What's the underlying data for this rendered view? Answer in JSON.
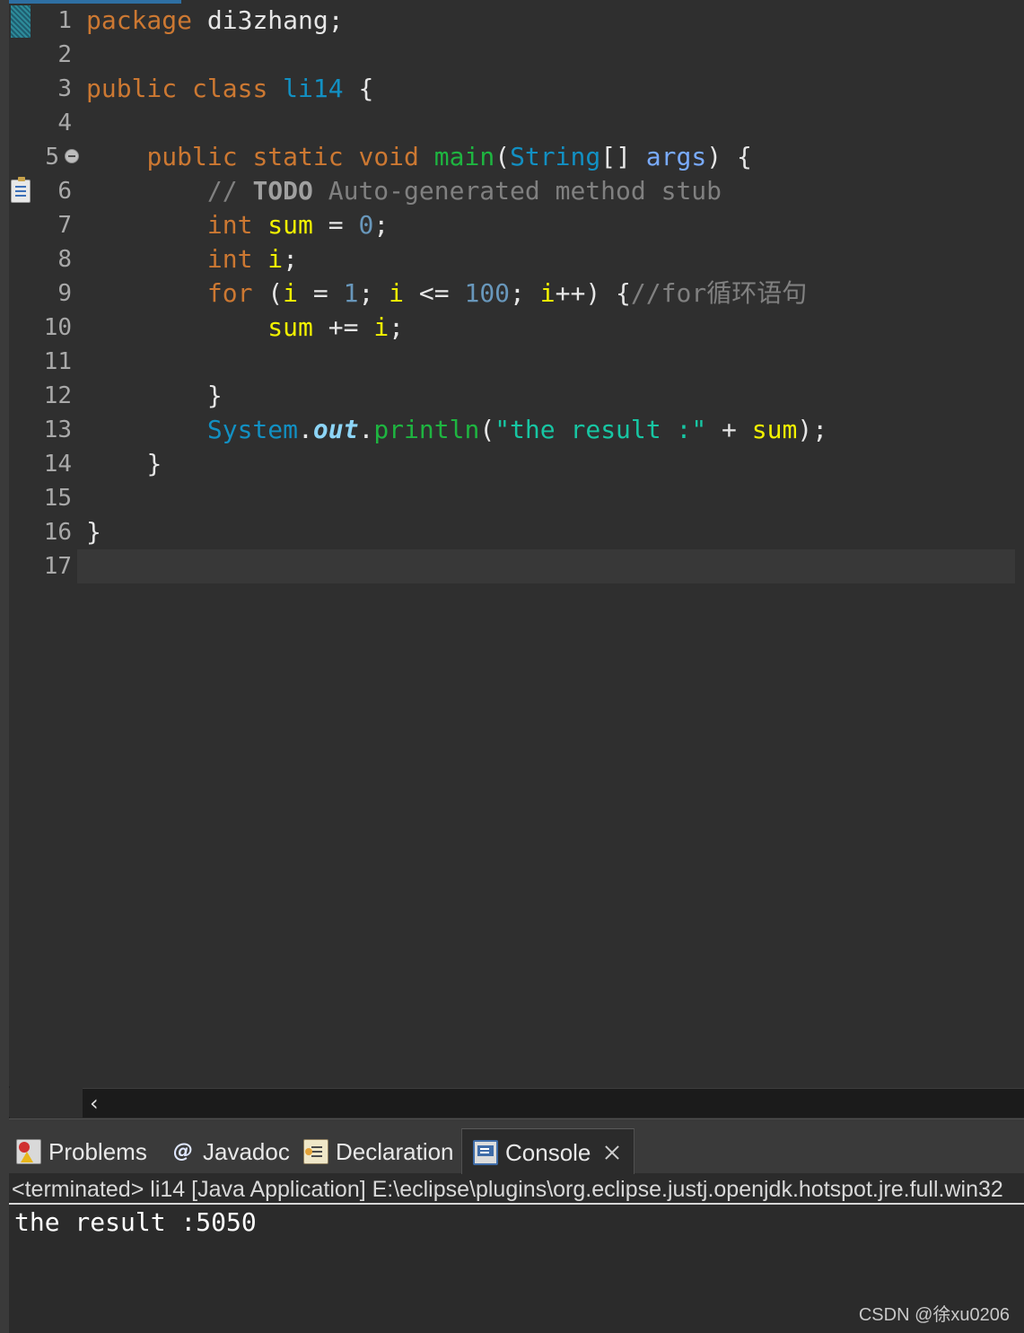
{
  "editor": {
    "line_numbers": [
      "1",
      "2",
      "3",
      "4",
      "5",
      "6",
      "7",
      "8",
      "9",
      "10",
      "11",
      "12",
      "13",
      "14",
      "15",
      "16",
      "17"
    ],
    "code": {
      "l1": {
        "kw": "package",
        "rest": " di3zhang;"
      },
      "l3": {
        "kw1": "public",
        "kw2": "class",
        "cls": "li14",
        "rest": " {"
      },
      "l5": {
        "kw1": "public",
        "kw2": "static",
        "kw3": "void",
        "fn": "main",
        "p1": "(",
        "ty": "String",
        "p2": "[] ",
        "arg": "args",
        "p3": ") {"
      },
      "l6": {
        "c1": "// ",
        "todo": "TODO",
        "c2": " Auto-generated method stub"
      },
      "l7": {
        "kw": "int",
        "var": "sum",
        "op": " = ",
        "num": "0",
        "end": ";"
      },
      "l8": {
        "kw": "int",
        "var": "i",
        "end": ";"
      },
      "l9": {
        "kw": "for",
        "p1": " (",
        "v1": "i",
        "op1": " = ",
        "n1": "1",
        "p2": "; ",
        "v2": "i",
        "op2": " <= ",
        "n2": "100",
        "p3": "; ",
        "v3": "i",
        "op3": "++) {",
        "cm": "//for循环语句"
      },
      "l10": {
        "var": "sum",
        "op": " += ",
        "var2": "i",
        "end": ";"
      },
      "l12": {
        "brace": "}"
      },
      "l13": {
        "sys": "System",
        "dot1": ".",
        "out": "out",
        "dot2": ".",
        "fn": "println",
        "p1": "(",
        "str": "\"the result :\"",
        "op": " + ",
        "var": "sum",
        "end": ");"
      },
      "l14": {
        "brace": "}"
      },
      "l16": {
        "brace": "}"
      }
    },
    "scroll_left_arrow": "‹"
  },
  "panel": {
    "tabs": [
      {
        "label": "Problems",
        "icon": "problems-icon"
      },
      {
        "label": "Javadoc",
        "icon": "javadoc-icon",
        "glyph": "@"
      },
      {
        "label": "Declaration",
        "icon": "declaration-icon"
      },
      {
        "label": "Console",
        "icon": "console-icon",
        "active": true
      }
    ],
    "console_header": "<terminated> li14 [Java Application] E:\\eclipse\\plugins\\org.eclipse.justj.openjdk.hotspot.jre.full.win32",
    "console_output": "the result :5050"
  },
  "watermark": "CSDN @徐xu0206",
  "colors": {
    "background": "#2f2f2f",
    "keyword": "#cc7832",
    "type": "#1290c3",
    "method": "#1eb540",
    "local_variable": "#f2f200",
    "number": "#6897bb",
    "string": "#17c6a3",
    "comment": "#808080"
  }
}
